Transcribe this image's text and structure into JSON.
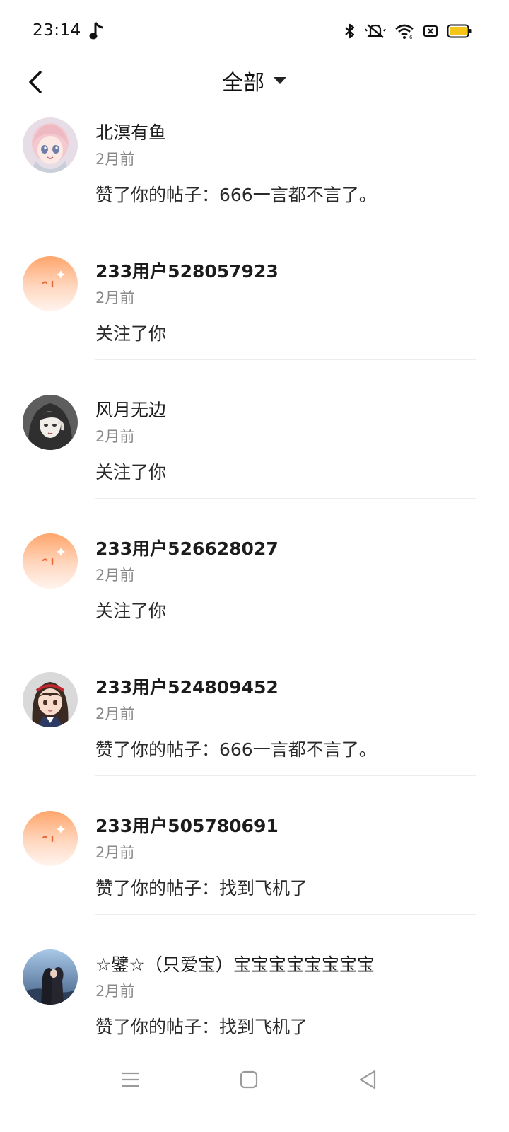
{
  "status_bar": {
    "time": "23:14",
    "icons": [
      "music-note-icon",
      "bluetooth-icon",
      "mute-icon",
      "wifi-icon",
      "sim-icon",
      "battery-icon"
    ],
    "battery_color": "#f5c518"
  },
  "header": {
    "filter_label": "全部",
    "back_icon": "chevron-left-icon",
    "dropdown_icon": "caret-down-icon"
  },
  "notifications": [
    {
      "name": "北溟有鱼",
      "bold": false,
      "time": "2月前",
      "action": "赞了你的帖子：666一言都不言了。",
      "avatar": "anime-girl-pink-hair"
    },
    {
      "name": "233用户528057923",
      "bold": true,
      "time": "2月前",
      "action": "关注了你",
      "avatar": "default-orange"
    },
    {
      "name": "风月无边",
      "bold": false,
      "time": "2月前",
      "action": "关注了你",
      "avatar": "dark-hair-girl"
    },
    {
      "name": "233用户526628027",
      "bold": true,
      "time": "2月前",
      "action": "关注了你",
      "avatar": "default-orange"
    },
    {
      "name": "233用户524809452",
      "bold": true,
      "time": "2月前",
      "action": "赞了你的帖子：666一言都不言了。",
      "avatar": "anime-girl-headband"
    },
    {
      "name": "233用户505780691",
      "bold": true,
      "time": "2月前",
      "action": "赞了你的帖子：找到飞机了",
      "avatar": "default-orange"
    },
    {
      "name": "☆鐾☆（只爱宝）宝宝宝宝宝宝宝宝",
      "bold": false,
      "time": "2月前",
      "action": "赞了你的帖子：找到飞机了",
      "avatar": "couple-photo"
    }
  ],
  "nav_bar": {
    "icons": [
      "menu-icon",
      "home-square-icon",
      "back-triangle-icon"
    ]
  }
}
